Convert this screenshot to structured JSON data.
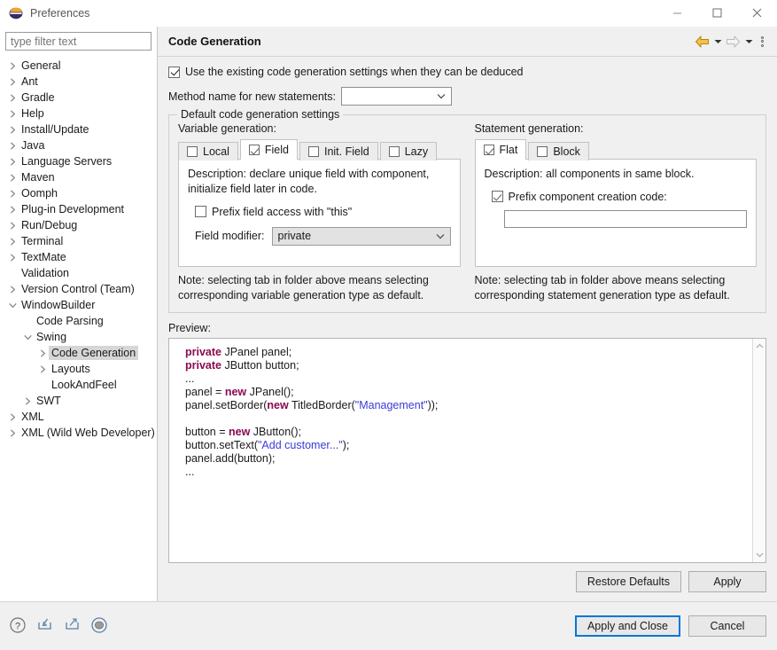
{
  "window": {
    "title": "Preferences",
    "app_icon": "eclipse-icon",
    "controls": {
      "minimize": "–",
      "maximize": "☐",
      "close": "✕"
    }
  },
  "sidebar": {
    "filter": {
      "placeholder": "type filter text",
      "value": ""
    },
    "items": [
      {
        "label": "General",
        "indent": 0,
        "expander": "collapsed"
      },
      {
        "label": "Ant",
        "indent": 0,
        "expander": "collapsed"
      },
      {
        "label": "Gradle",
        "indent": 0,
        "expander": "collapsed"
      },
      {
        "label": "Help",
        "indent": 0,
        "expander": "collapsed"
      },
      {
        "label": "Install/Update",
        "indent": 0,
        "expander": "collapsed"
      },
      {
        "label": "Java",
        "indent": 0,
        "expander": "collapsed"
      },
      {
        "label": "Language Servers",
        "indent": 0,
        "expander": "collapsed"
      },
      {
        "label": "Maven",
        "indent": 0,
        "expander": "collapsed"
      },
      {
        "label": "Oomph",
        "indent": 0,
        "expander": "collapsed"
      },
      {
        "label": "Plug-in Development",
        "indent": 0,
        "expander": "collapsed"
      },
      {
        "label": "Run/Debug",
        "indent": 0,
        "expander": "collapsed"
      },
      {
        "label": "Terminal",
        "indent": 0,
        "expander": "collapsed"
      },
      {
        "label": "TextMate",
        "indent": 0,
        "expander": "collapsed"
      },
      {
        "label": "Validation",
        "indent": 0,
        "expander": "none"
      },
      {
        "label": "Version Control (Team)",
        "indent": 0,
        "expander": "collapsed"
      },
      {
        "label": "WindowBuilder",
        "indent": 0,
        "expander": "expanded"
      },
      {
        "label": "Code Parsing",
        "indent": 1,
        "expander": "none"
      },
      {
        "label": "Swing",
        "indent": 1,
        "expander": "expanded"
      },
      {
        "label": "Code Generation",
        "indent": 2,
        "expander": "collapsed",
        "selected": true
      },
      {
        "label": "Layouts",
        "indent": 2,
        "expander": "collapsed"
      },
      {
        "label": "LookAndFeel",
        "indent": 2,
        "expander": "none"
      },
      {
        "label": "SWT",
        "indent": 1,
        "expander": "collapsed"
      },
      {
        "label": "XML",
        "indent": 0,
        "expander": "collapsed"
      },
      {
        "label": "XML (Wild Web Developer)",
        "indent": 0,
        "expander": "collapsed"
      }
    ]
  },
  "page": {
    "title": "Code Generation",
    "toolbar": {
      "back_icon": "back-arrow-icon",
      "back_menu_icon": "chevron-down-icon",
      "forward_icon": "forward-arrow-icon",
      "forward_menu_icon": "chevron-down-icon",
      "overflow_icon": "vertical-dots-icon"
    },
    "use_existing": {
      "label": "Use the existing code generation settings when they can be deduced",
      "checked": true
    },
    "method_name": {
      "label": "Method name for new statements:",
      "value": "",
      "arrow_icon": "chevron-down-icon"
    },
    "group": {
      "title": "Default code generation settings",
      "variable": {
        "lead": "Variable generation:",
        "tabs": [
          {
            "label": "Local",
            "checked": false,
            "active": false
          },
          {
            "label": "Field",
            "checked": true,
            "active": true
          },
          {
            "label": "Init. Field",
            "checked": false,
            "active": false
          },
          {
            "label": "Lazy",
            "checked": false,
            "active": false
          }
        ],
        "description": "Description: declare unique field with component, initialize field later in code.",
        "prefix_this": {
          "label": "Prefix field access with \"this\"",
          "checked": false
        },
        "field_modifier": {
          "label": "Field modifier:",
          "value": "private",
          "arrow_icon": "chevron-down-icon"
        },
        "note": "Note: selecting tab in folder above means selecting corresponding variable generation type as default."
      },
      "statement": {
        "lead": "Statement generation:",
        "tabs": [
          {
            "label": "Flat",
            "checked": true,
            "active": true
          },
          {
            "label": "Block",
            "checked": false,
            "active": false
          }
        ],
        "description": "Description: all components in same block.",
        "prefix_creation": {
          "label": "Prefix component creation code:",
          "checked": true
        },
        "prefix_value": "",
        "note": "Note: selecting tab in folder above means selecting corresponding statement generation type as default."
      }
    },
    "preview": {
      "label": "Preview:",
      "lines": [
        [
          {
            "t": "private",
            "c": "kw"
          },
          {
            "t": " JPanel panel;",
            "c": ""
          }
        ],
        [
          {
            "t": "private",
            "c": "kw"
          },
          {
            "t": " JButton button;",
            "c": ""
          }
        ],
        [
          {
            "t": "...",
            "c": ""
          }
        ],
        [
          {
            "t": "panel = ",
            "c": ""
          },
          {
            "t": "new",
            "c": "kw"
          },
          {
            "t": " JPanel();",
            "c": ""
          }
        ],
        [
          {
            "t": "panel.setBorder(",
            "c": ""
          },
          {
            "t": "new",
            "c": "kw"
          },
          {
            "t": " TitledBorder(",
            "c": ""
          },
          {
            "t": "\"Management\"",
            "c": "str"
          },
          {
            "t": "));",
            "c": ""
          }
        ],
        [
          {
            "t": "",
            "c": ""
          }
        ],
        [
          {
            "t": "button = ",
            "c": ""
          },
          {
            "t": "new",
            "c": "kw"
          },
          {
            "t": " JButton();",
            "c": ""
          }
        ],
        [
          {
            "t": "button.setText(",
            "c": ""
          },
          {
            "t": "\"Add customer...\"",
            "c": "str"
          },
          {
            "t": ");",
            "c": ""
          }
        ],
        [
          {
            "t": "panel.add(button);",
            "c": ""
          }
        ],
        [
          {
            "t": "...",
            "c": ""
          }
        ]
      ],
      "scroll_up_icon": "chevron-up-icon",
      "scroll_down_icon": "chevron-down-icon"
    },
    "actions": {
      "restore_defaults": "Restore Defaults",
      "apply": "Apply"
    }
  },
  "footer": {
    "icons": [
      {
        "name": "help-icon",
        "glyph": "?"
      },
      {
        "name": "import-icon",
        "glyph": "import"
      },
      {
        "name": "export-icon",
        "glyph": "export"
      },
      {
        "name": "record-icon",
        "glyph": "record"
      }
    ],
    "apply_and_close": "Apply and Close",
    "cancel": "Cancel"
  },
  "colors": {
    "accent": "#0078d7",
    "selection": "#d6d6d6",
    "keyword": "#8b0a50",
    "string": "#3b3bd6",
    "back_arrow": "#e8a317"
  }
}
